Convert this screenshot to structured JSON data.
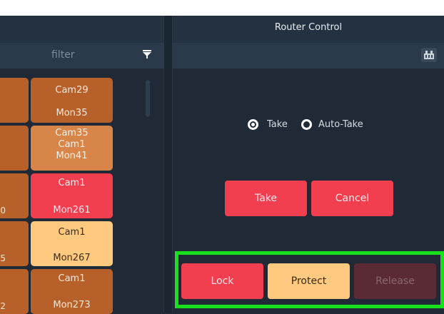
{
  "router_control": {
    "title": "Router Control",
    "mode_options": [
      {
        "label": "Take",
        "selected": true
      },
      {
        "label": "Auto-Take",
        "selected": false
      }
    ],
    "take_button": "Take",
    "cancel_button": "Cancel",
    "lock_button": "Lock",
    "protect_button": "Protect",
    "release_button": "Release"
  },
  "source_panel": {
    "filter_placeholder": "filter",
    "tiles": [
      {
        "lines": [
          "Cam29",
          "",
          "Mon35"
        ],
        "partial_label": ""
      },
      {
        "lines": [
          "Cam35",
          "Cam1",
          "Mon41"
        ],
        "partial_label": ""
      },
      {
        "lines": [
          "Cam1",
          "",
          "Mon261"
        ],
        "partial_label": "0"
      },
      {
        "lines": [
          "Cam1",
          "",
          "Mon267"
        ],
        "partial_label": "5"
      },
      {
        "lines": [
          "Cam1",
          "",
          "Mon273"
        ],
        "partial_label": "2"
      }
    ]
  },
  "colors": {
    "tile_orange": "#b8602a",
    "tile_orange_light": "#d8854a",
    "tile_red": "#f23f4f",
    "tile_peach": "#ffc980",
    "highlight_green": "#18e01c"
  },
  "icons": {
    "filter": "filter-icon",
    "tool": "router-tool-icon"
  }
}
